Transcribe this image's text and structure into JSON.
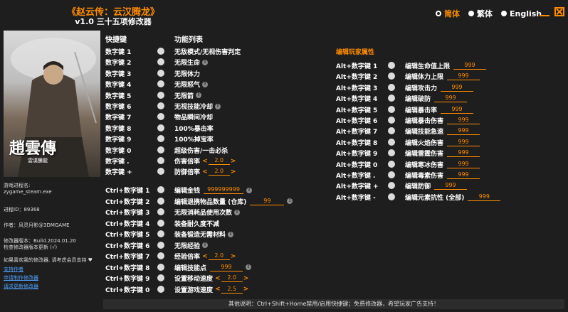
{
  "header": {
    "title": "《赵云传：云汉腾龙》",
    "subtitle": "v1.0 三十五项修改器",
    "languages": [
      {
        "label": "简体",
        "selected": true
      },
      {
        "label": "繁体",
        "selected": false
      },
      {
        "label": "English",
        "selected": false
      }
    ]
  },
  "cover": {
    "title_glyphs": "趙雲傳",
    "subtitle": "雲漢騰龍"
  },
  "sidebar": {
    "process_label": "游戏进程名:",
    "process_name": "zygame_steam.exe",
    "pid": "进程ID：89368",
    "author": "作者：风灵月影@3DMGAME",
    "version": "修改器版本：Build.2024.01.20",
    "check_update": "检查修改器版本更新 (√)",
    "support_text": "如果喜欢我的修改器, 请考虑会员支持 ♥",
    "links": [
      "支持作者",
      "申请制作修改器",
      "请求更新修改器"
    ]
  },
  "columns": {
    "hotkey": "快捷键",
    "function": "功能列表"
  },
  "left_rows": [
    {
      "key": "数字键 1",
      "label": "无敌模式/无视伤害判定",
      "info": false
    },
    {
      "key": "数字键 2",
      "label": "无限生命",
      "info": true
    },
    {
      "key": "数字键 3",
      "label": "无限体力",
      "info": false
    },
    {
      "key": "数字键 4",
      "label": "无限怒气",
      "info": true
    },
    {
      "key": "数字键 5",
      "label": "无限箭",
      "info": true
    },
    {
      "key": "数字键 6",
      "label": "无视技能冷却",
      "info": true
    },
    {
      "key": "数字键 7",
      "label": "物品瞬间冷却",
      "info": false
    },
    {
      "key": "数字键 8",
      "label": "100%暴击率",
      "info": false
    },
    {
      "key": "数字键 9",
      "label": "100%掉宝率",
      "info": false
    },
    {
      "key": "数字键 0",
      "label": "超级伤害/一击必杀",
      "info": false
    },
    {
      "key": "数字键 .",
      "label": "伤害倍率",
      "value": "2.0",
      "arrows": true
    },
    {
      "key": "数字键 +",
      "label": "防御倍率",
      "value": "2.0",
      "arrows": true
    }
  ],
  "ctrl_rows": [
    {
      "key": "Ctrl+数字键 1",
      "label": "编辑金钱",
      "value": "999999999",
      "info": true
    },
    {
      "key": "Ctrl+数字键 2",
      "label": "编辑退携物品数量 (仓库)",
      "value": "99",
      "info": true
    },
    {
      "key": "Ctrl+数字键 3",
      "label": "无限消耗品使用次数",
      "info": true
    },
    {
      "key": "Ctrl+数字键 4",
      "label": "装备耐久度不减",
      "info": false
    },
    {
      "key": "Ctrl+数字键 5",
      "label": "装备锻造无需材料",
      "info": true
    },
    {
      "key": "Ctrl+数字键 6",
      "label": "无限经验",
      "info": true
    },
    {
      "key": "Ctrl+数字键 7",
      "label": "经验倍率",
      "value": "2.0",
      "arrows": true
    },
    {
      "key": "Ctrl+数字键 8",
      "label": "编辑技能点",
      "value": "999",
      "info": true
    },
    {
      "key": "Ctrl+数字键 9",
      "label": "设置移动速度",
      "value": "2.0",
      "arrows": true
    },
    {
      "key": "Ctrl+数字键 0",
      "label": "设置游戏速度",
      "value": "2.5",
      "arrows": true
    }
  ],
  "player_section": {
    "title": "编辑玩家属性",
    "rows": [
      {
        "key": "Alt+数字键 1",
        "label": "编辑生命值上限",
        "value": "999"
      },
      {
        "key": "Alt+数字键 2",
        "label": "编辑体力上限",
        "value": "999"
      },
      {
        "key": "Alt+数字键 3",
        "label": "编辑攻击力",
        "value": "999"
      },
      {
        "key": "Alt+数字键 4",
        "label": "编辑破防",
        "value": "999"
      },
      {
        "key": "Alt+数字键 5",
        "label": "编辑暴击率",
        "value": "999"
      },
      {
        "key": "Alt+数字键 6",
        "label": "编辑暴击伤害",
        "value": "999"
      },
      {
        "key": "Alt+数字键 7",
        "label": "编辑技能急速",
        "value": "999"
      },
      {
        "key": "Alt+数字键 8",
        "label": "编辑火焰伤害",
        "value": "999"
      },
      {
        "key": "Alt+数字键 9",
        "label": "编辑雷霆伤害",
        "value": "999"
      },
      {
        "key": "Alt+数字键 0",
        "label": "编辑寒冰伤害",
        "value": "999"
      },
      {
        "key": "Alt+数字键 .",
        "label": "编辑毒素伤害",
        "value": "999"
      },
      {
        "key": "Alt+数字键 +",
        "label": "编辑防御",
        "value": "999"
      },
      {
        "key": "Alt+数字键 -",
        "label": "编辑元素抗性 (全部)",
        "value": "999"
      }
    ]
  },
  "footer": {
    "text": "其他说明：Ctrl+Shift+Home禁用/启用快捷键；免费修改器，希望玩家广告支持！"
  },
  "colors": {
    "accent": "#ff8c00",
    "background": "#1e1e1e",
    "link": "#4da3ff"
  }
}
